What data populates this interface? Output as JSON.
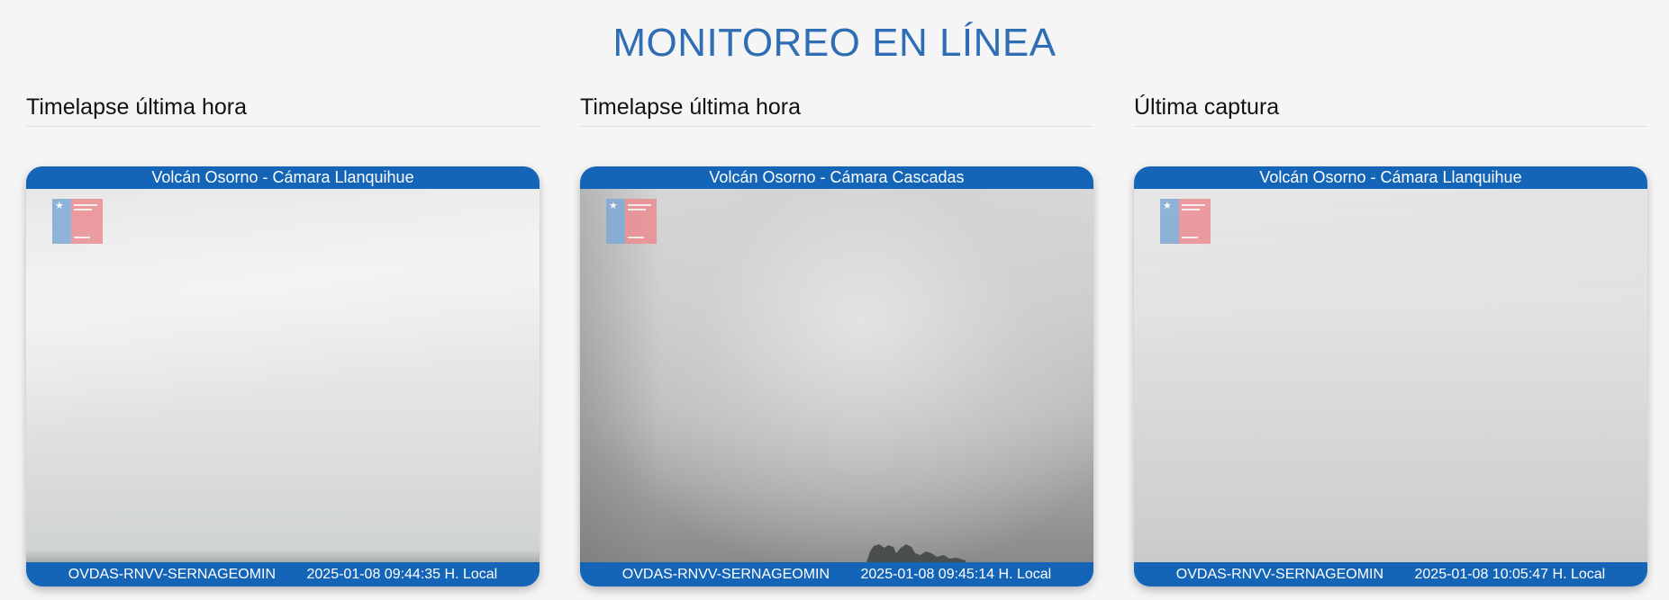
{
  "page": {
    "title": "MONITOREO EN LÍNEA"
  },
  "columns": [
    {
      "heading": "Timelapse última hora",
      "camera": {
        "title": "Volcán Osorno - Cámara Llanquihue",
        "station": "OVDAS-RNVV-SERNAGEOMIN",
        "timestamp": "2025-01-08 09:44:35 H. Local"
      }
    },
    {
      "heading": "Timelapse última hora",
      "camera": {
        "title": "Volcán Osorno - Cámara Cascadas",
        "station": "OVDAS-RNVV-SERNAGEOMIN",
        "timestamp": "2025-01-08 09:45:14 H. Local"
      }
    },
    {
      "heading": "Última captura",
      "camera": {
        "title": "Volcán Osorno - Cámara Llanquihue",
        "station": "OVDAS-RNVV-SERNAGEOMIN",
        "timestamp": "2025-01-08 10:05:47 H. Local"
      }
    }
  ],
  "theme": {
    "title_color": "#2f6eb5",
    "camera_bar_color": "#1465b8",
    "background": "#f5f5f5"
  },
  "icons": {
    "logo": "government-logo-icon"
  }
}
